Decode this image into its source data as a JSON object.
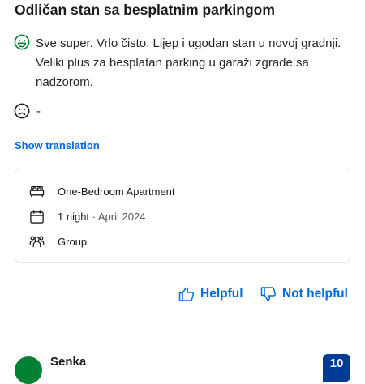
{
  "review": {
    "title": "Odličan stan sa besplatnim parkingom",
    "positive_text": "Sve super. Vrlo čisto. Lijep i ugodan stan u novoj gradnji. Veliki plus za besplatan parking u garaži zgrade sa nadzorom.",
    "negative_text": "-",
    "show_translation": "Show translation",
    "positive_icon": "smiley-happy-icon",
    "negative_icon": "smiley-sad-icon"
  },
  "stay_details": {
    "room": {
      "icon": "bed-icon",
      "label": "One-Bedroom Apartment"
    },
    "nights": {
      "icon": "calendar-icon",
      "label": "1 night",
      "separator": " · ",
      "date": "April 2024"
    },
    "traveler": {
      "icon": "group-icon",
      "label": "Group"
    }
  },
  "actions": {
    "helpful": "Helpful",
    "not_helpful": "Not helpful",
    "helpful_icon": "thumbs-up-icon",
    "not_helpful_icon": "thumbs-down-icon"
  },
  "next_review": {
    "reviewer_name": "Senka",
    "score": "10"
  },
  "colors": {
    "accent": "#006ce4",
    "positive": "#008234",
    "score_bg": "#003b95",
    "border": "#e7e7e7"
  }
}
